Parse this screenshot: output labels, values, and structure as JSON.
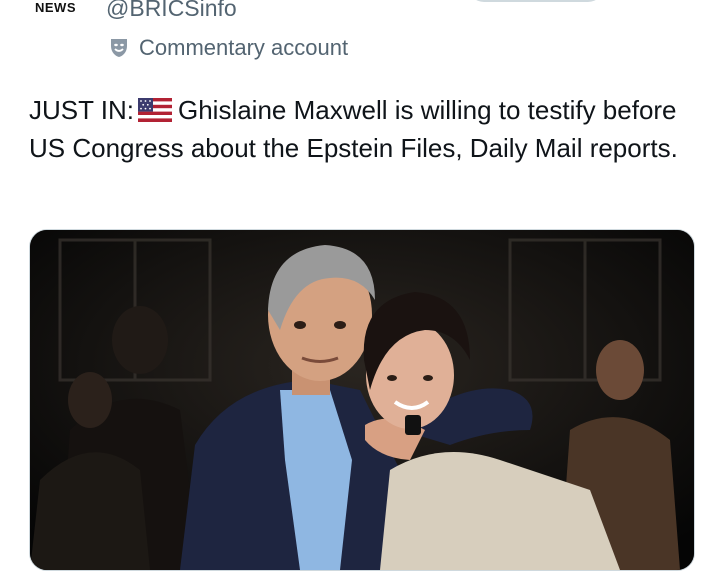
{
  "account": {
    "avatar_label": "NEWS",
    "avatar_icon": "news-logo",
    "handle": "@BRICSinfo",
    "label_icon": "theater-masks-icon",
    "label_text": "Commentary account"
  },
  "tweet": {
    "prefix": "JUST IN:",
    "flag_icon": "us-flag-icon",
    "body": "Ghislaine Maxwell is willing to testify before US Congress about the Epstein Files, Daily Mail reports."
  },
  "colors": {
    "text_primary": "#0f1419",
    "text_secondary": "#536471",
    "border": "#cfd9de"
  }
}
